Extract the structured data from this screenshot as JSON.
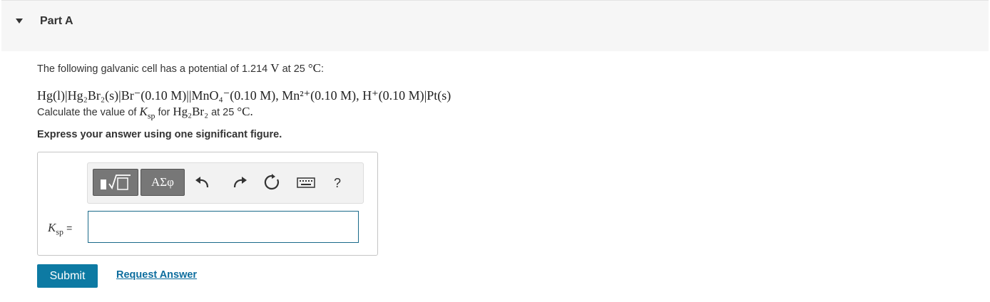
{
  "header": {
    "title": "Part A"
  },
  "question": {
    "intro_text": "The following galvanic cell has a potential of 1.214",
    "intro_unit": "V",
    "intro_at": "at 25",
    "intro_temp_unit": "°C",
    "intro_colon": ":",
    "cell_notation": "Hg(l)|Hg₂Br₂(s)|Br⁻(0.10 M)||MnO₄⁻(0.10 M), Mn²⁺(0.10 M), H⁺(0.10 M)|Pt(s)",
    "calc_prefix": "Calculate the value of",
    "calc_k": "K",
    "calc_k_sub": "sp",
    "calc_for": "for",
    "calc_compound": "Hg₂Br₂",
    "calc_at": "at 25",
    "calc_temp": "°C.",
    "instruction": "Express your answer using one significant figure."
  },
  "toolbar": {
    "templates_label": "",
    "greek_label": "ΑΣφ",
    "help_label": "?"
  },
  "answer": {
    "label_k": "K",
    "label_sub": "sp",
    "label_eq": "=",
    "value": ""
  },
  "actions": {
    "submit_label": "Submit",
    "request_label": "Request Answer"
  },
  "colors": {
    "header_bg": "#f6f6f6",
    "submit_bg": "#0d7aa3",
    "link": "#0d6d9e",
    "input_border": "#1a6a8a"
  }
}
